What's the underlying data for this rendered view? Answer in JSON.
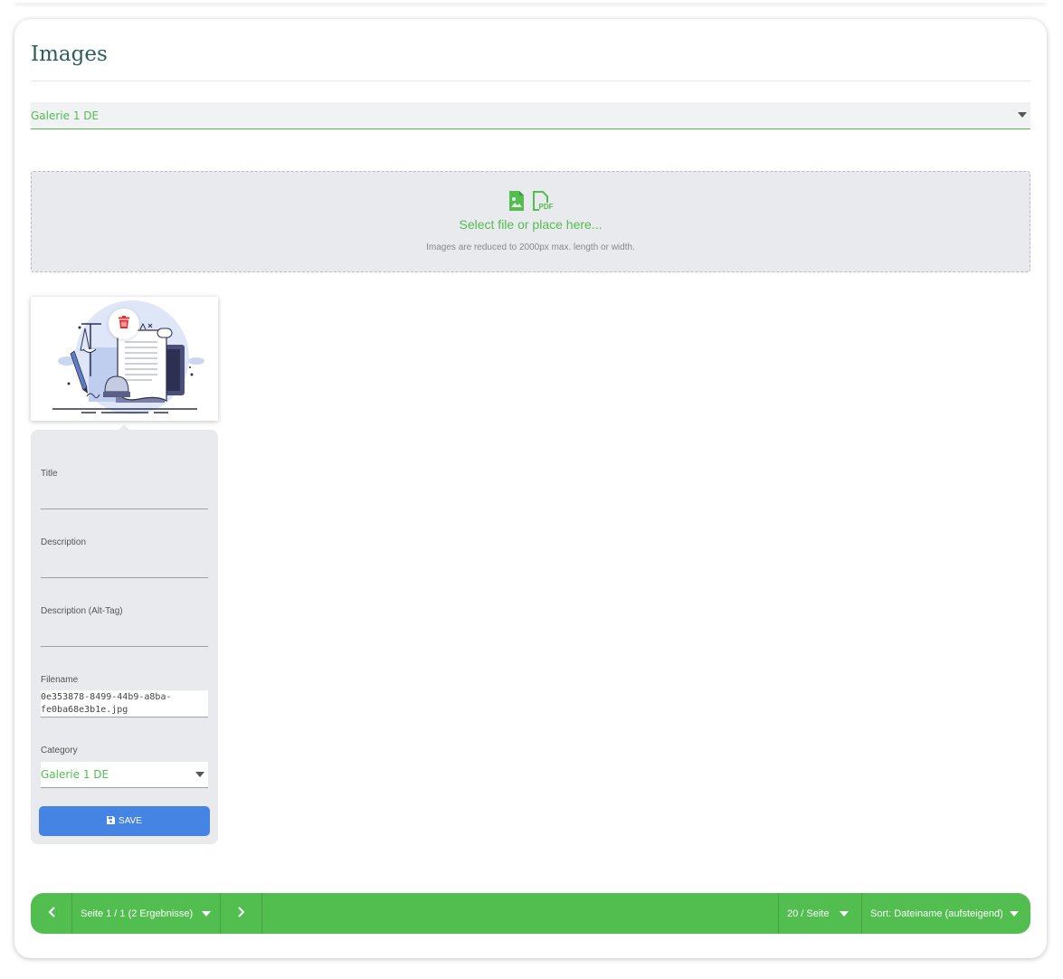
{
  "page": {
    "title": "Images"
  },
  "gallery_select": {
    "value": "Galerie 1 DE"
  },
  "dropzone": {
    "main_text": "Select file or place here...",
    "note": "Images are reduced to 2000px max. length or width.",
    "icons": [
      "file-image-icon",
      "file-pdf-icon"
    ],
    "pdf_badge": "PDF"
  },
  "image_card": {
    "fields": {
      "title_label": "Title",
      "title_value": "",
      "description_label": "Description",
      "description_value": "",
      "alt_label": "Description (Alt-Tag)",
      "alt_value": "",
      "filename_label": "Filename",
      "filename_value": "0e353878-8499-44b9-a8ba-fe0ba68e3b1e.jpg",
      "category_label": "Category",
      "category_value": "Galerie 1 DE"
    },
    "save_label": "SAVE"
  },
  "pagination": {
    "page_info": "Seite 1 / 1 (2 Ergebnisse)",
    "per_page": "20 / Seite",
    "sort": "Sort: Dateiname (aufsteigend)"
  },
  "colors": {
    "accent_green": "#52be4f",
    "save_blue": "#4584e3",
    "delete_red": "#e03131",
    "title_color": "#2e5e5a"
  }
}
